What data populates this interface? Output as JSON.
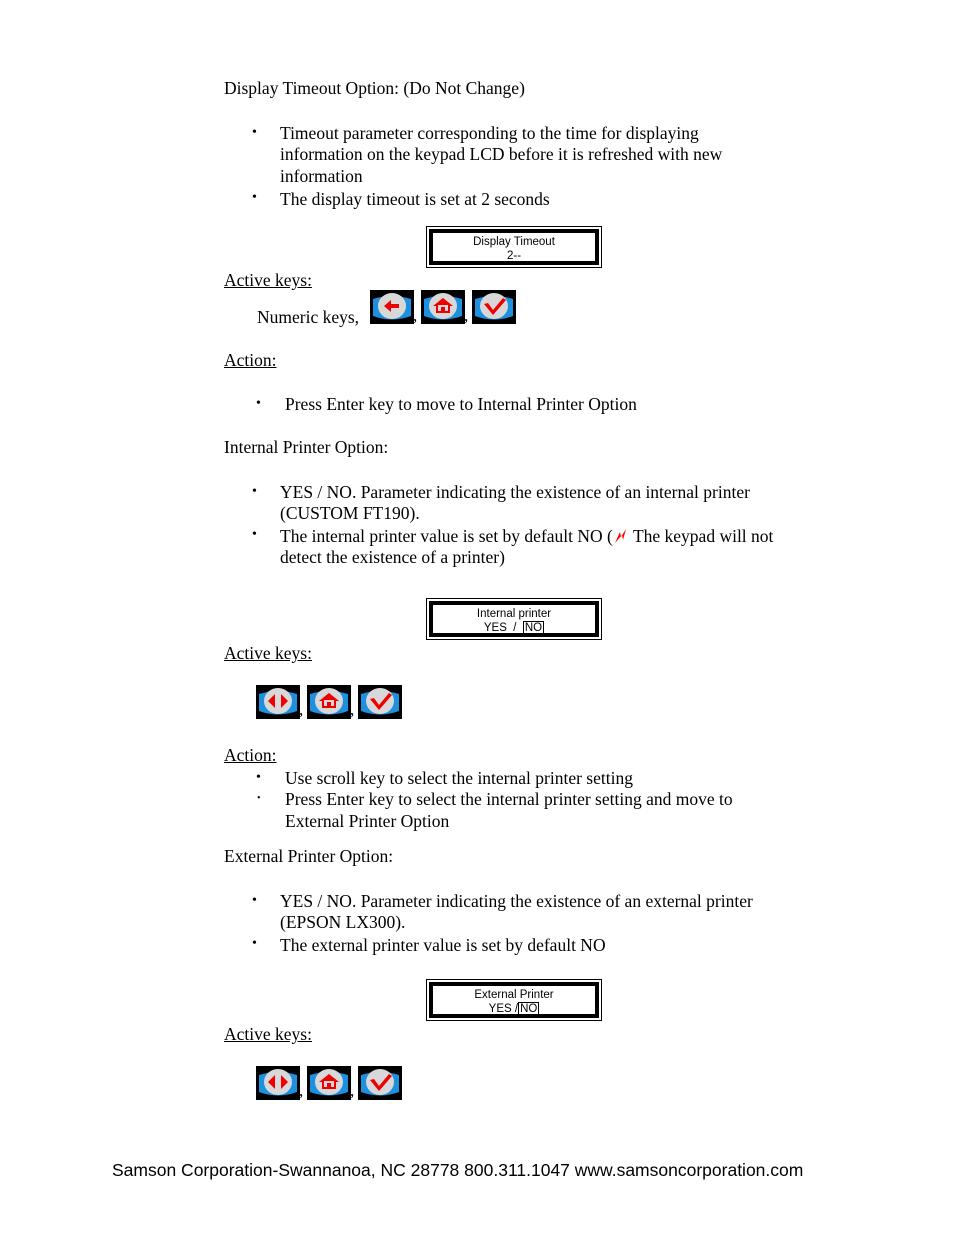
{
  "sections": {
    "display_timeout": {
      "heading": "Display Timeout Option: (Do Not Change)",
      "bullets": [
        "Timeout parameter corresponding to the time for displaying",
        "information on the keypad LCD before it is refreshed with new",
        "information",
        "The display timeout is set at 2 seconds"
      ],
      "lcd": {
        "line1": "Display Timeout",
        "line2": "2--"
      },
      "active_keys_label": "Active keys:",
      "numeric_keys_label": "Numeric keys,",
      "keys": [
        "back-arrow-key",
        "home-key",
        "enter-check-key"
      ],
      "action_label": "Action:",
      "actions": [
        "Press Enter key to move to Internal Printer Option"
      ]
    },
    "internal_printer": {
      "heading": "Internal Printer Option:",
      "bullet1_line1": "YES / NO. Parameter indicating the existence of an internal printer",
      "bullet1_line2": "(CUSTOM FT190).",
      "bullet2_pre": "The internal printer value is set by default NO (",
      "bullet2_post": " The keypad will not",
      "bullet2_line2": "detect the existence of a printer)",
      "warning_icon_color": "#ff0000",
      "lcd": {
        "line1": "Internal printer",
        "yes": "YES",
        "sep": "/",
        "no": "NO"
      },
      "active_keys_label": "Active keys:",
      "keys": [
        "scroll-left-right-key",
        "home-key",
        "enter-check-key"
      ],
      "action_label": "Action:",
      "actions_line1": "Use scroll key to select the internal printer setting",
      "actions_line2": "Press Enter key to select the internal printer setting and move to",
      "actions_line3": "External Printer Option"
    },
    "external_printer": {
      "heading": "External Printer Option:",
      "bullet1_line1": "YES / NO. Parameter indicating the existence of an external printer",
      "bullet1_line2": "(EPSON LX300).",
      "bullet2": "The external printer value is set by default NO",
      "lcd": {
        "line1": "External Printer",
        "yes": "YES",
        "sep": "/",
        "no": "NO"
      },
      "active_keys_label": "Active keys:",
      "keys": [
        "scroll-left-right-key",
        "home-key",
        "enter-check-key"
      ]
    }
  },
  "punctuation": {
    "comma": ",",
    "bullet": "•"
  },
  "footer": "Samson Corporation-Swannanoa, NC 28778  800.311.1047 www.samsoncorporation.com",
  "colors": {
    "key_blue": "#1e90e0",
    "key_face": "#d8d8d8",
    "key_symbol": "#ee0000"
  }
}
